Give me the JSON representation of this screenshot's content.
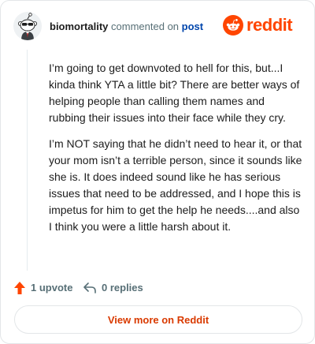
{
  "header": {
    "username": "biomortality",
    "action_text": "commented on",
    "post_link": "post",
    "brand_name": "reddit"
  },
  "comment": {
    "paragraphs": [
      "I’m going to get downvoted to hell for this, but...I kinda think YTA a little bit? There are better ways of helping people than calling them names and rubbing their issues into their face while they cry.",
      "I’m NOT saying that he didn’t need to hear it, or that your mom isn’t a terrible person, since it sounds like she is. It does indeed sound like he has serious issues that need to be addressed, and I hope this is impetus for him to get the help he needs....and also I think you were a little harsh about it."
    ]
  },
  "actions": {
    "upvote_label": "1 upvote",
    "replies_label": "0 replies"
  },
  "footer": {
    "view_more_label": "View more on Reddit"
  },
  "colors": {
    "brand": "#ff4500",
    "link": "#0045ac",
    "muted": "#576f76",
    "view_more": "#d93a00"
  },
  "icons": {
    "avatar": "snoo-avatar-icon",
    "logo": "reddit-logo-icon",
    "upvote": "upvote-arrow-icon",
    "reply": "reply-arrow-icon"
  }
}
